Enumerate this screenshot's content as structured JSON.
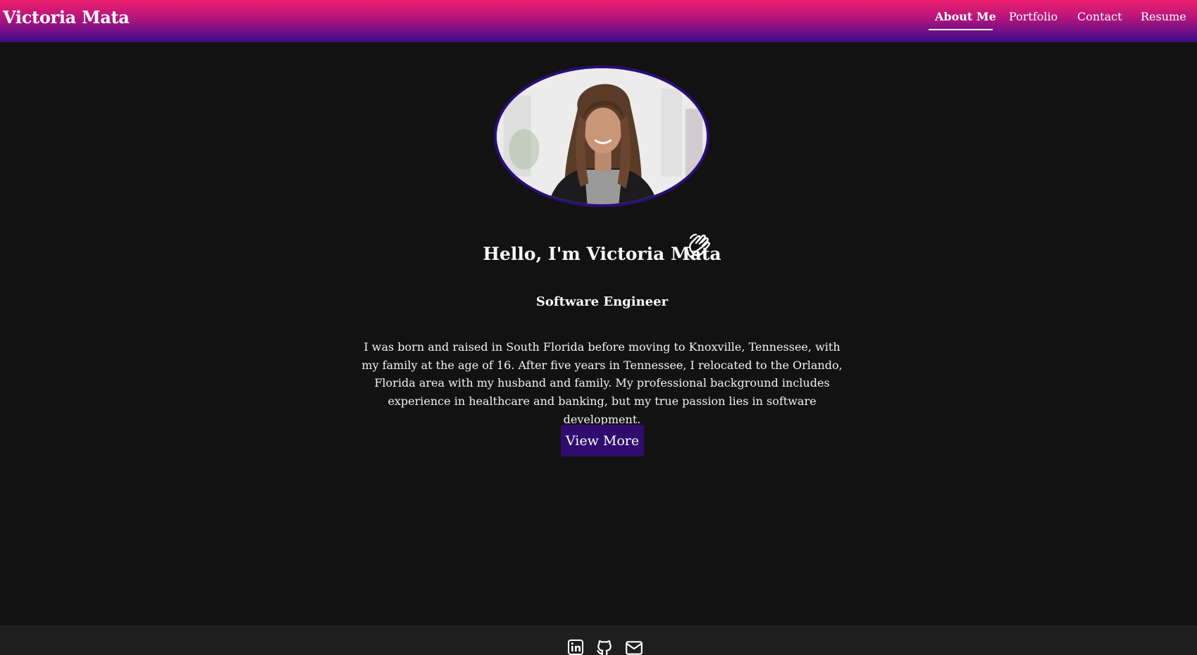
{
  "header": {
    "brand": "Victoria Mata",
    "nav": [
      {
        "label": "About Me",
        "active": true
      },
      {
        "label": "Portfolio",
        "active": false
      },
      {
        "label": "Contact",
        "active": false
      },
      {
        "label": "Resume",
        "active": false
      }
    ]
  },
  "profile": {
    "greeting": "Hello, I'm Victoria Mata",
    "greeting_icon": "waving-hand-icon",
    "role": "Software Engineer",
    "bio": "I was born and raised in South Florida before moving to Knoxville, Tennessee, with my family at the age of 16. After five years in Tennessee, I relocated to the Orlando, Florida area with my husband and family. My professional background includes experience in healthcare and banking, but my true passion lies in software development.",
    "button_label": "View More"
  },
  "footer": {
    "icons": [
      "linkedin-icon",
      "github-icon",
      "email-icon"
    ]
  },
  "colors": {
    "header_gradient_top": "#ee1f6e",
    "header_gradient_bottom": "#3d0a86",
    "background": "#121212",
    "button": "#300b6e",
    "footer": "#1f1f1f",
    "photo_border": "#2a0e7a"
  }
}
